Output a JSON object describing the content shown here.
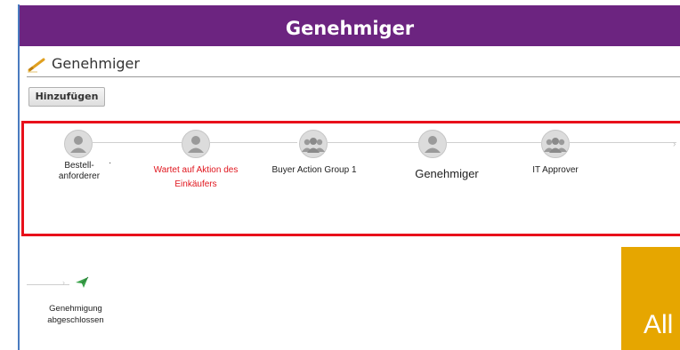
{
  "banner": {
    "title": "Genehmiger"
  },
  "section": {
    "title": "Genehmiger",
    "icon": "pencil-icon"
  },
  "toolbar": {
    "add_label": "Hinzufügen"
  },
  "flow": {
    "steps": [
      {
        "label_line1": "Bestell-",
        "label_line2": "anforderer",
        "icon": "person-icon"
      },
      {
        "label_line1": "Wartet auf Aktion des",
        "label_line2": "Einkäufers",
        "icon": "person-icon",
        "status_color": "#e0161e"
      },
      {
        "label_line1": "Buyer Action Group 1",
        "label_line2": "",
        "icon": "group-icon"
      },
      {
        "label_line1": "Genehmiger",
        "label_line2": "",
        "icon": "person-icon"
      },
      {
        "label_line1": "IT Approver",
        "label_line2": "",
        "icon": "group-icon"
      }
    ],
    "separator": "·"
  },
  "completion": {
    "line1": "Genehmigung",
    "line2": "abgeschlossen",
    "icon": "paper-plane-icon"
  },
  "tile": {
    "text": "All"
  },
  "colors": {
    "banner": "#6c2480",
    "highlight_border": "#e8101a",
    "tile": "#e6a600"
  }
}
